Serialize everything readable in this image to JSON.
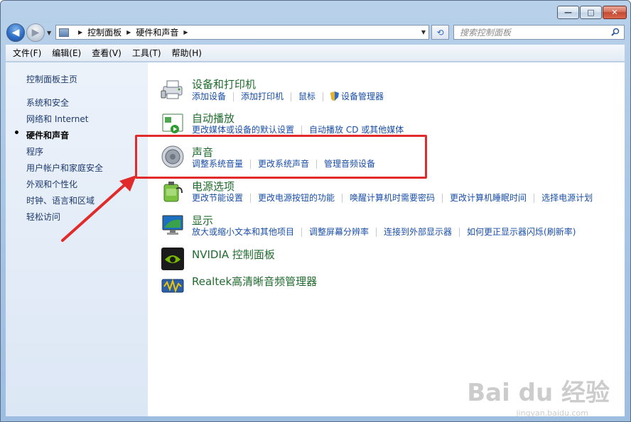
{
  "window": {
    "caption": {
      "minimize": "—",
      "maximize": "□",
      "close": "✕"
    }
  },
  "nav": {
    "back_icon": "back-arrow-icon",
    "forward_icon": "forward-arrow-icon",
    "address": [
      "控制面板",
      "硬件和声音"
    ],
    "search_placeholder": "搜索控制面板"
  },
  "menubar": [
    "文件(F)",
    "编辑(E)",
    "查看(V)",
    "工具(T)",
    "帮助(H)"
  ],
  "sidebar": {
    "home": "控制面板主页",
    "items": [
      {
        "label": "系统和安全",
        "active": false
      },
      {
        "label": "网络和 Internet",
        "active": false
      },
      {
        "label": "硬件和声音",
        "active": true
      },
      {
        "label": "程序",
        "active": false
      },
      {
        "label": "用户帐户和家庭安全",
        "active": false
      },
      {
        "label": "外观和个性化",
        "active": false
      },
      {
        "label": "时钟、语言和区域",
        "active": false
      },
      {
        "label": "轻松访问",
        "active": false
      }
    ]
  },
  "categories": [
    {
      "title": "设备和打印机",
      "icon": "printer-icon",
      "links": [
        "添加设备",
        "添加打印机",
        "鼠标",
        "设备管理器"
      ]
    },
    {
      "title": "自动播放",
      "icon": "autoplay-icon",
      "links": [
        "更改媒体或设备的默认设置",
        "自动播放 CD 或其他媒体"
      ]
    },
    {
      "title": "声音",
      "icon": "speaker-icon",
      "links": [
        "调整系统音量",
        "更改系统声音",
        "管理音频设备"
      ]
    },
    {
      "title": "电源选项",
      "icon": "power-icon",
      "links": [
        "更改节能设置",
        "更改电源按钮的功能",
        "唤醒计算机时需要密码",
        "更改计算机睡眠时间",
        "选择电源计划"
      ]
    },
    {
      "title": "显示",
      "icon": "display-icon",
      "links": [
        "放大或缩小文本和其他项目",
        "调整屏幕分辨率",
        "连接到外部显示器",
        "如何更正显示器闪烁(刷新率)"
      ]
    },
    {
      "title": "NVIDIA 控制面板",
      "icon": "nvidia-icon",
      "links": []
    },
    {
      "title": "Realtek高清晰音频管理器",
      "icon": "realtek-icon",
      "links": []
    }
  ],
  "watermark": {
    "main": "Bai du 经验",
    "sub": "jingyan.baidu.com"
  },
  "colors": {
    "category_title": "#1f6b2d",
    "link": "#1a4ea8",
    "highlight": "#e12a2a"
  }
}
